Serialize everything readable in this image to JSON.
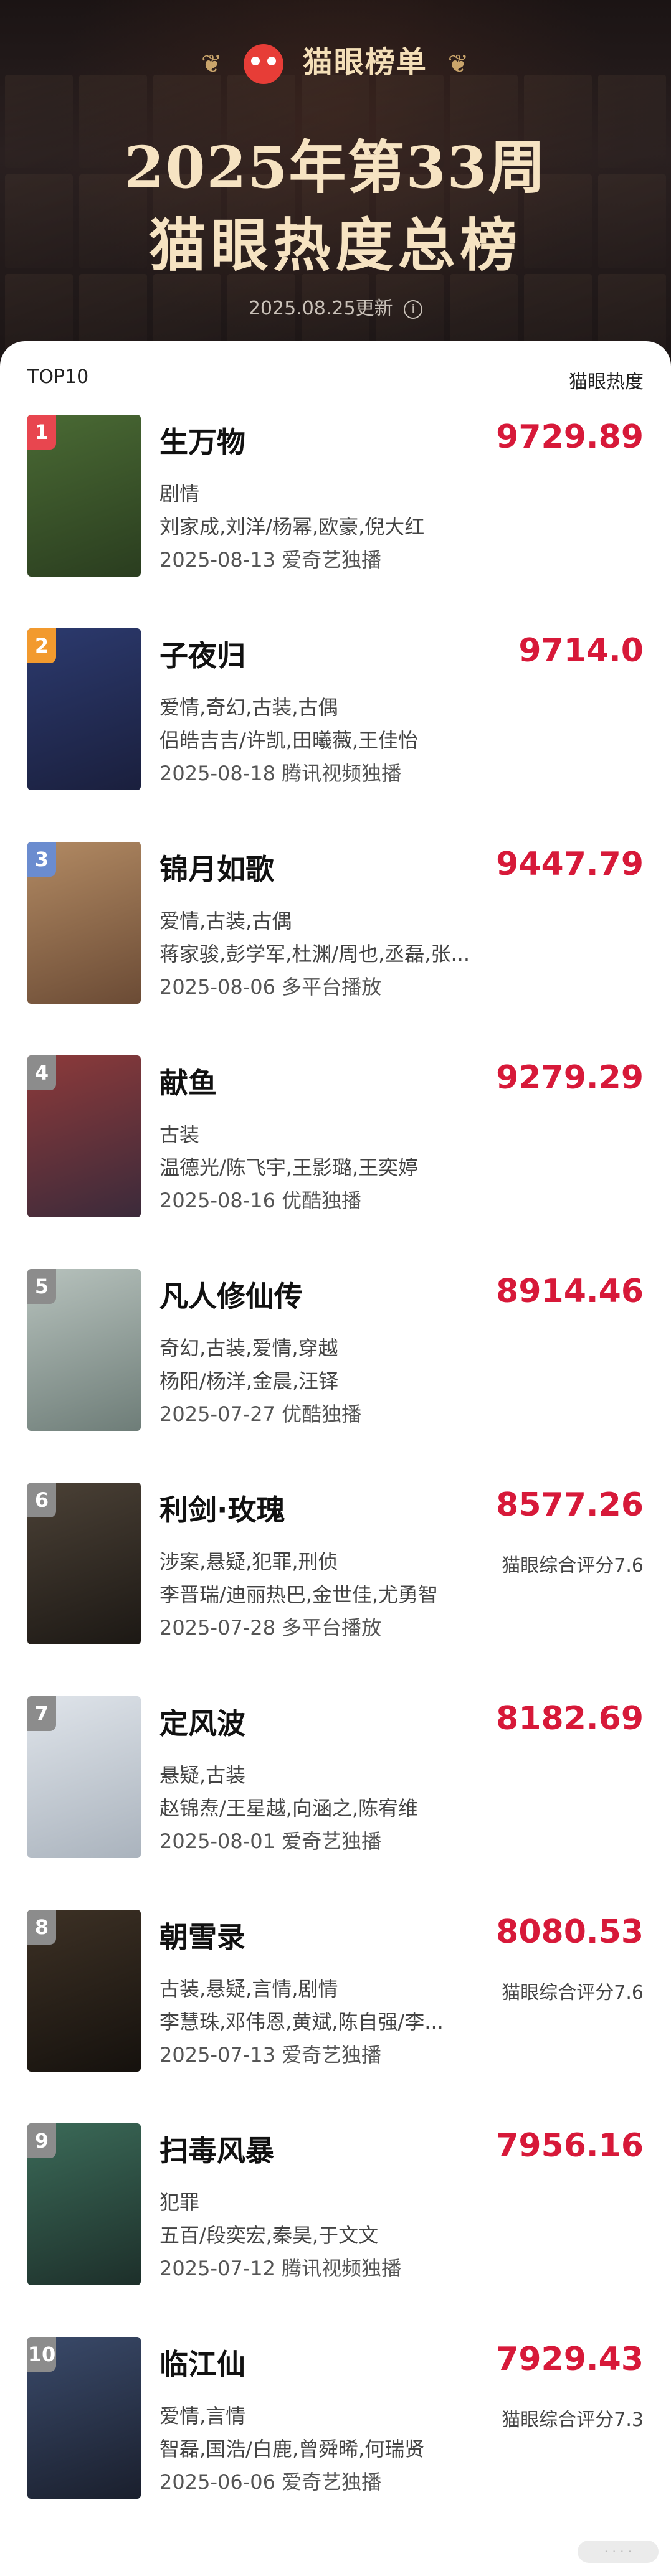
{
  "brand": {
    "name": "猫眼榜单"
  },
  "title_line1": "2025年第33周",
  "title_line2": "猫眼热度总榜",
  "updated": "2025.08.25更新",
  "header": {
    "left": "TOP10",
    "right": "猫眼热度"
  },
  "items": [
    {
      "rank": "1",
      "name": "生万物",
      "score": "9729.89",
      "genre": "剧情",
      "cast": "刘家成,刘洋/杨幂,欧豪,倪大红",
      "date": "2025-08-13 爱奇艺独播",
      "rating": "",
      "rank_color": "#e8464f",
      "poster_colors": [
        "#4a6a34",
        "#2a3d1f"
      ]
    },
    {
      "rank": "2",
      "name": "子夜归",
      "score": "9714.0",
      "genre": "爱情,奇幻,古装,古偶",
      "cast": "侣皓吉吉/许凯,田曦薇,王佳怡",
      "date": "2025-08-18 腾讯视频独播",
      "rating": "",
      "rank_color": "#f29a2e",
      "poster_colors": [
        "#2c3a6e",
        "#1a1f3d"
      ]
    },
    {
      "rank": "3",
      "name": "锦月如歌",
      "score": "9447.79",
      "genre": "爱情,古装,古偶",
      "cast": "蒋家骏,彭学军,杜渊/周也,丞磊,张...",
      "date": "2025-08-06 多平台播放",
      "rating": "",
      "rank_color": "#6b8ccf",
      "poster_colors": [
        "#b28a63",
        "#6b4b35"
      ]
    },
    {
      "rank": "4",
      "name": "献鱼",
      "score": "9279.29",
      "genre": "古装",
      "cast": "温德光/陈飞宇,王影璐,王奕婷",
      "date": "2025-08-16 优酷独播",
      "rating": "",
      "rank_color": "#8c8c8c",
      "poster_colors": [
        "#8d3a3a",
        "#3b2a3a"
      ]
    },
    {
      "rank": "5",
      "name": "凡人修仙传",
      "score": "8914.46",
      "genre": "奇幻,古装,爱情,穿越",
      "cast": "杨阳/杨洋,金晨,汪铎",
      "date": "2025-07-27 优酷独播",
      "rating": "",
      "rank_color": "#8c8c8c",
      "poster_colors": [
        "#b7c2bd",
        "#6e7d78"
      ]
    },
    {
      "rank": "6",
      "name": "利剑·玫瑰",
      "score": "8577.26",
      "genre": "涉案,悬疑,犯罪,刑侦",
      "cast": "李晋瑞/迪丽热巴,金世佳,尤勇智",
      "date": "2025-07-28 多平台播放",
      "rating": "猫眼综合评分7.6",
      "rank_color": "#8c8c8c",
      "poster_colors": [
        "#4b4136",
        "#1c1814"
      ]
    },
    {
      "rank": "7",
      "name": "定风波",
      "score": "8182.69",
      "genre": "悬疑,古装",
      "cast": "赵锦焘/王星越,向涵之,陈宥维",
      "date": "2025-08-01 爱奇艺独播",
      "rating": "",
      "rank_color": "#8c8c8c",
      "poster_colors": [
        "#dfe4ea",
        "#aab3bd"
      ]
    },
    {
      "rank": "8",
      "name": "朝雪录",
      "score": "8080.53",
      "genre": "古装,悬疑,言情,剧情",
      "cast": "李慧珠,邓伟恩,黄斌,陈自强/李...",
      "date": "2025-07-13 爱奇艺独播",
      "rating": "猫眼综合评分7.6",
      "rank_color": "#8c8c8c",
      "poster_colors": [
        "#3d3125",
        "#15110d"
      ]
    },
    {
      "rank": "9",
      "name": "扫毒风暴",
      "score": "7956.16",
      "genre": "犯罪",
      "cast": "五百/段奕宏,秦昊,于文文",
      "date": "2025-07-12 腾讯视频独播",
      "rating": "",
      "rank_color": "#8c8c8c",
      "poster_colors": [
        "#3b6a58",
        "#1d2f2a"
      ]
    },
    {
      "rank": "10",
      "name": "临江仙",
      "score": "7929.43",
      "genre": "爱情,言情",
      "cast": "智磊,国浩/白鹿,曾舜晞,何瑞贤",
      "date": "2025-06-06 爱奇艺独播",
      "rating": "猫眼综合评分7.3",
      "rank_color": "#8c8c8c",
      "poster_colors": [
        "#3a4a6a",
        "#1a1f2d"
      ]
    }
  ]
}
